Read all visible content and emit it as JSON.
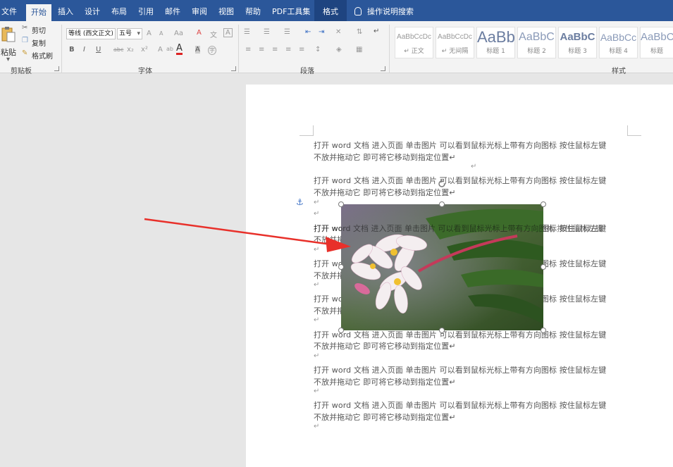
{
  "ribbon_tabs": {
    "file": "文件",
    "home": "开始",
    "insert": "插入",
    "design": "设计",
    "layout": "布局",
    "references": "引用",
    "mailings": "邮件",
    "review": "审阅",
    "view": "视图",
    "help": "帮助",
    "pdf_tools": "PDF工具集",
    "format": "格式",
    "tell_me": "操作说明搜索"
  },
  "clipboard": {
    "paste": "粘贴",
    "cut": "剪切",
    "copy": "复制",
    "format_painter": "格式刷",
    "group_label": "剪贴板"
  },
  "font": {
    "font_name": "等线 (西文正文)",
    "font_size": "五号",
    "grow": "A",
    "shrink": "A",
    "change_case": "Aa",
    "clear_format": "A",
    "phonetic": "文",
    "char_border": "A",
    "bold": "B",
    "italic": "I",
    "underline": "U",
    "strikethrough": "abc",
    "subscript": "x₂",
    "superscript": "x²",
    "text_effect": "A",
    "highlight": "ab",
    "font_color": "A",
    "char_shading": "A",
    "enclose": "字",
    "group_label": "字体"
  },
  "paragraph": {
    "group_label": "段落"
  },
  "styles": {
    "items": [
      {
        "sample": "AaBbCcDc",
        "name": "↵ 正文"
      },
      {
        "sample": "AaBbCcDc",
        "name": "↵ 无间隔"
      },
      {
        "sample": "AaBb",
        "name": "标题 1"
      },
      {
        "sample": "AaBbC",
        "name": "标题 2"
      },
      {
        "sample": "AaBbC",
        "name": "标题 3"
      },
      {
        "sample": "AaBbCc",
        "name": "标题 4"
      },
      {
        "sample": "AaBbC",
        "name": "标题"
      }
    ],
    "group_label": "样式"
  },
  "document": {
    "line_a": "打开 word 文档    进入页面    单击图片    可以看到鼠标光标上带有方向图标    按住鼠标左键",
    "line_b": "不放并拖动它    即可将它移动到指定位置↵",
    "para_mark": "↵"
  },
  "colors": {
    "ribbon_blue": "#2b579a",
    "arrow_red": "#e8302a"
  },
  "icons": {
    "anchor": "⚓"
  }
}
